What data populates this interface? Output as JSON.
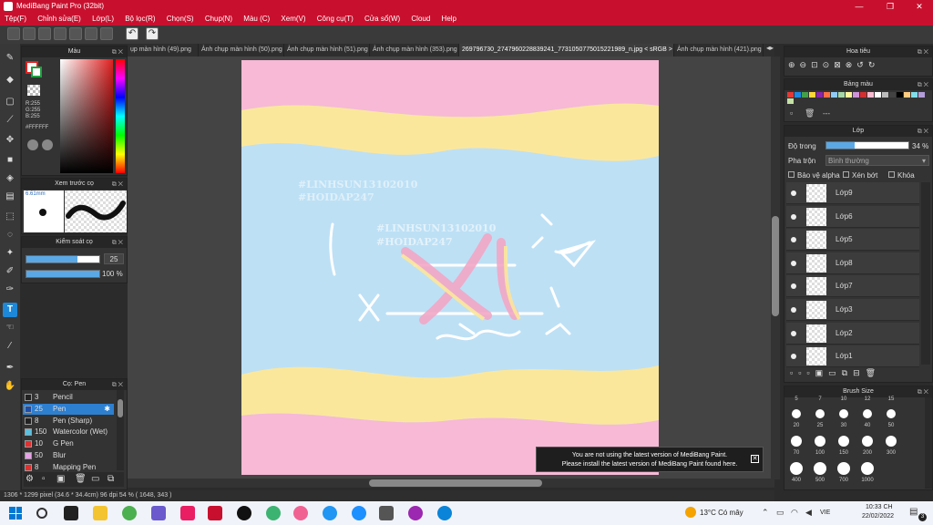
{
  "title": "MediBang Paint Pro (32bit)",
  "menu": [
    "Tệp(F)",
    "Chỉnh sửa(E)",
    "Lớp(L)",
    "Bộ lọc(R)",
    "Chọn(S)",
    "Chụp(N)",
    "Màu (C)",
    "Xem(V)",
    "Công cụ(T)",
    "Cửa sổ(W)",
    "Cloud",
    "Help"
  ],
  "tabs": [
    "ụp màn hình (49).png",
    "Ảnh chụp màn hình (50).png",
    "Ảnh chụp màn hình (51).png",
    "Ảnh chụp màn hình (353).png",
    "269796730_2747960228839241_7731050775015221989_n.jpg < sRGB >",
    "Ảnh chụp màn hình (421).png"
  ],
  "color_panel": {
    "title": "Màu",
    "r": "R:255",
    "g": "G:255",
    "b": "B:255",
    "hex": "#FFFFFF"
  },
  "preview_panel": {
    "title": "Xem trước cọ",
    "size": "6.61mm"
  },
  "brush_control": {
    "title": "Kiểm soát cọ",
    "size": "25",
    "opacity": "100 %",
    "size_fill": 0.7,
    "opacity_fill": 1.0
  },
  "brush_panel": {
    "title": "Cọ: Pen",
    "items": [
      {
        "size": "3",
        "name": "Pencil",
        "color": "#222222"
      },
      {
        "size": "25",
        "name": "Pen",
        "color": "#1e4fa8",
        "selected": true
      },
      {
        "size": "8",
        "name": "Pen (Sharp)",
        "color": "#222222"
      },
      {
        "size": "150",
        "name": "Watercolor (Wet)",
        "color": "#5bc0de"
      },
      {
        "size": "10",
        "name": "G Pen",
        "color": "#e03030"
      },
      {
        "size": "50",
        "name": "Blur",
        "color": "#e8a0e8"
      },
      {
        "size": "8",
        "name": "Mapping Pen",
        "color": "#e03030"
      }
    ]
  },
  "navigator": {
    "title": "Hoa tiêu"
  },
  "palette": {
    "title": "Bảng màu",
    "menu": "---"
  },
  "layer_panel": {
    "title": "Lớp",
    "opacity_label": "Độ trong",
    "opacity": "34 %",
    "opacity_fill": 0.34,
    "blend_label": "Pha trộn",
    "blend_value": "Bình thường",
    "protect_alpha": "Bảo vệ alpha",
    "clip": "Xén bớt",
    "lock": "Khóa",
    "layers": [
      "Lớp9",
      "Lớp6",
      "Lớp5",
      "Lớp8",
      "Lớp7",
      "Lớp3",
      "Lớp2",
      "Lớp1"
    ]
  },
  "brush_size_panel": {
    "title": "Brush Size",
    "top_labels": [
      "5",
      "7",
      "10",
      "12",
      "15"
    ],
    "sizes": [
      "20",
      "25",
      "30",
      "40",
      "50",
      "70",
      "100",
      "150",
      "200",
      "300",
      "400",
      "500",
      "700",
      "1000"
    ]
  },
  "canvas_text": {
    "watermark1": "#LINHSUN13102010",
    "watermark2": "#HOIDAP247"
  },
  "notification": {
    "line1": "You are not using the latest version of MediBang Paint.",
    "line2": "Please install the latest version of MediBang Paint found here."
  },
  "status": {
    "text": "1306 * 1299 pixel  (34.6 * 34.4cm)  96 dpi  54 %  ( 1648, 343 )"
  },
  "taskbar": {
    "weather": "13°C  Có mây",
    "lang": "VIE",
    "time": "10:33 CH",
    "date": "22/02/2022",
    "notif_count": "3"
  }
}
